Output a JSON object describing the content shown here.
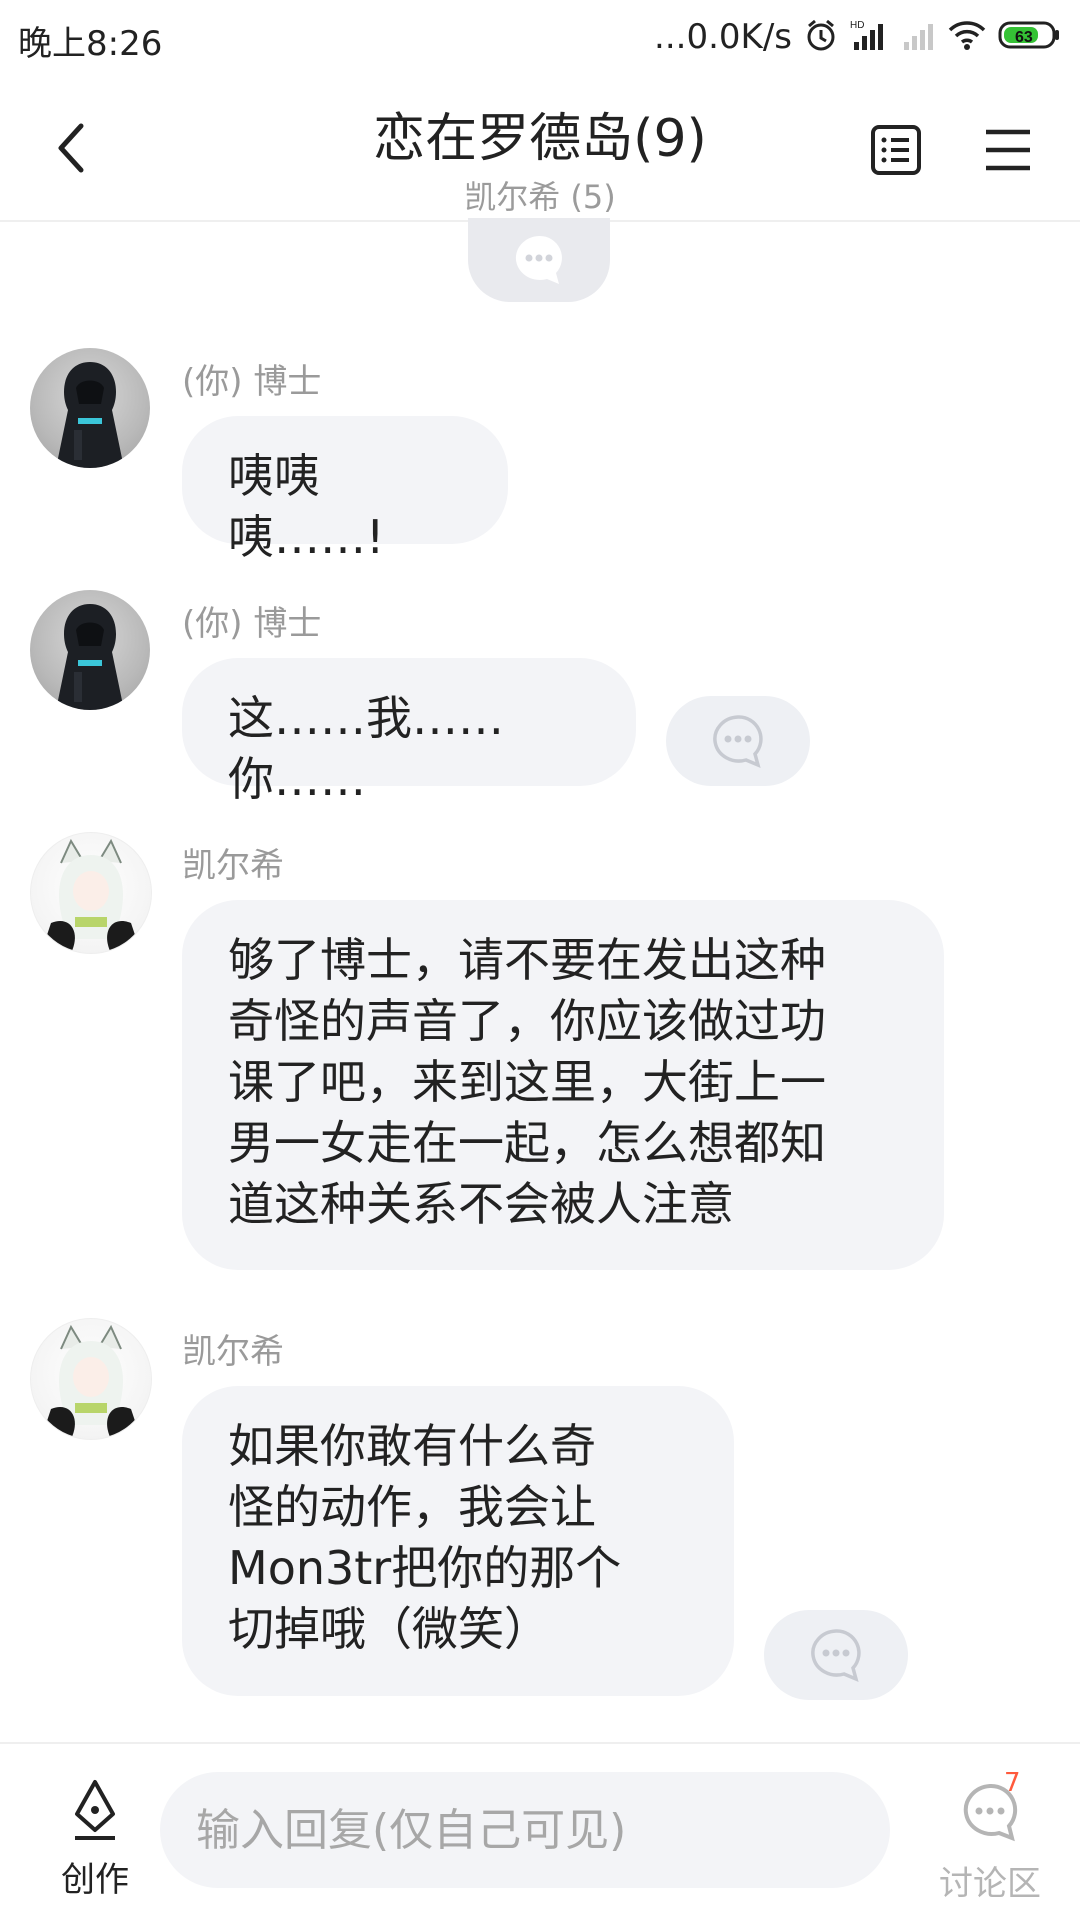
{
  "status_bar": {
    "time": "晚上8:26",
    "net_speed": "...0.0K/s",
    "battery": "63"
  },
  "header": {
    "title": "恋在罗德岛(9)",
    "subtitle": "凯尔希 (5)"
  },
  "messages": [
    {
      "sender": "(你) 博士",
      "lines": [
        "咦咦咦……!"
      ]
    },
    {
      "sender": "(你) 博士",
      "lines": [
        "这……我……你……"
      ]
    },
    {
      "sender": "凯尔希",
      "lines": [
        "够了博士，请不要在发出这种",
        "奇怪的声音了，你应该做过功",
        "课了吧，来到这里，大街上一",
        "男一女走在一起，怎么想都知",
        "道这种关系不会被人注意"
      ]
    },
    {
      "sender": "凯尔希",
      "lines": [
        "如果你敢有什么奇",
        "怪的动作，我会让",
        "Mon3tr把你的那个",
        "切掉哦（微笑）"
      ]
    }
  ],
  "bottom": {
    "create_label": "创作",
    "input_placeholder": "输入回复(仅自己可见)",
    "discuss_label": "讨论区",
    "discuss_badge": "7"
  },
  "colors": {
    "bubble": "#f3f4f7",
    "muted_text": "#9a9a9a",
    "badge": "#ff5a3c",
    "battery": "#35c235"
  }
}
